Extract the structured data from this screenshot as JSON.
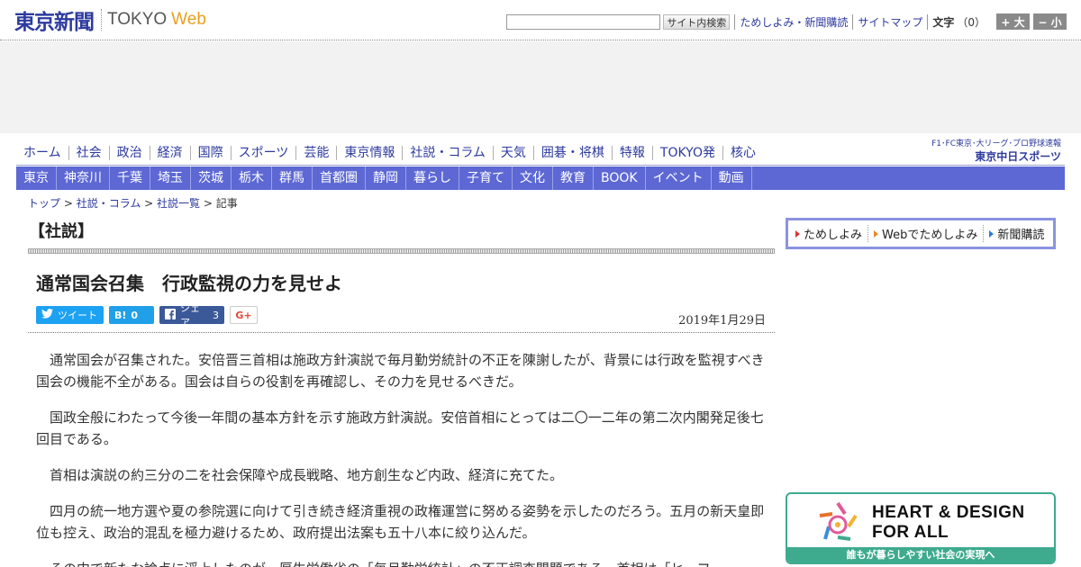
{
  "header": {
    "logo_jp": "東京新聞",
    "logo_tokyo": "TOKYO",
    "logo_web": "Web",
    "search_button": "サイト内検索",
    "links": [
      "ためしよみ・新聞購読",
      "サイトマップ"
    ],
    "font_size_label": "文字",
    "font_size_value": "（0）",
    "size_up": "+ 大",
    "size_down": "− 小"
  },
  "main_nav": [
    "ホーム",
    "社会",
    "政治",
    "経済",
    "国際",
    "スポーツ",
    "芸能",
    "東京情報",
    "社説・コラム",
    "天気",
    "囲碁・将棋",
    "特報",
    "TOKYO発",
    "核心"
  ],
  "chunichi": {
    "line1": "F1･FC東京･大リーグ･プロ野球速報",
    "line2": "東京中日スポーツ"
  },
  "sub_nav": [
    "東京",
    "神奈川",
    "千葉",
    "埼玉",
    "茨城",
    "栃木",
    "群馬",
    "首都圏",
    "静岡",
    "暮らし",
    "子育て",
    "文化",
    "教育",
    "BOOK",
    "イベント",
    "動画"
  ],
  "breadcrumb": {
    "items": [
      "トップ",
      "社説・コラム",
      "社説一覧"
    ],
    "current": "記事",
    "sep": " > "
  },
  "article": {
    "section": "【社説】",
    "headline": "通常国会召集　行政監視の力を見せよ",
    "date": "2019年1月29日",
    "share": {
      "tweet": "ツイート",
      "hatena_icon": "B!",
      "hatena_count": "0",
      "facebook_label": "シェア",
      "facebook_count": "3",
      "gplus": "G+"
    },
    "paragraphs": [
      "通常国会が召集された。安倍晋三首相は施政方針演説で毎月勤労統計の不正を陳謝したが、背景には行政を監視すべき国会の機能不全がある。国会は自らの役割を再確認し、その力を見せるべきだ。",
      "国政全般にわたって今後一年間の基本方針を示す施政方針演説。安倍首相にとっては二〇一二年の第二次内閣発足後七回目である。",
      "首相は演説の約三分の二を社会保障や成長戦略、地方創生など内政、経済に充てた。",
      "四月の統一地方選や夏の参院選に向けて引き続き経済重視の政権運営に努める姿勢を示したのだろう。五月の新天皇即位も控え、政治的混乱を極力避けるため、政府提出法案も五十八本に絞り込んだ。",
      "その中で新たな論点に浮上したのが、厚生労働省の「毎月勤労統計」の不正調査問題である。首相は「ヒーフ"
    ]
  },
  "sidebar": {
    "subscribe": [
      "ためしよみ",
      "Webでためしよみ",
      "新聞購読"
    ],
    "banner_title_1": "HEART & DESIGN",
    "banner_title_2": "FOR ALL",
    "banner_footer": "誰もが暮らしやすい社会の実現へ"
  },
  "colors": {
    "brand_blue": "#2d3a9e",
    "subnav_bg": "#5d68d4",
    "web_orange": "#e8a021",
    "banner_green": "#3eaa8e"
  }
}
